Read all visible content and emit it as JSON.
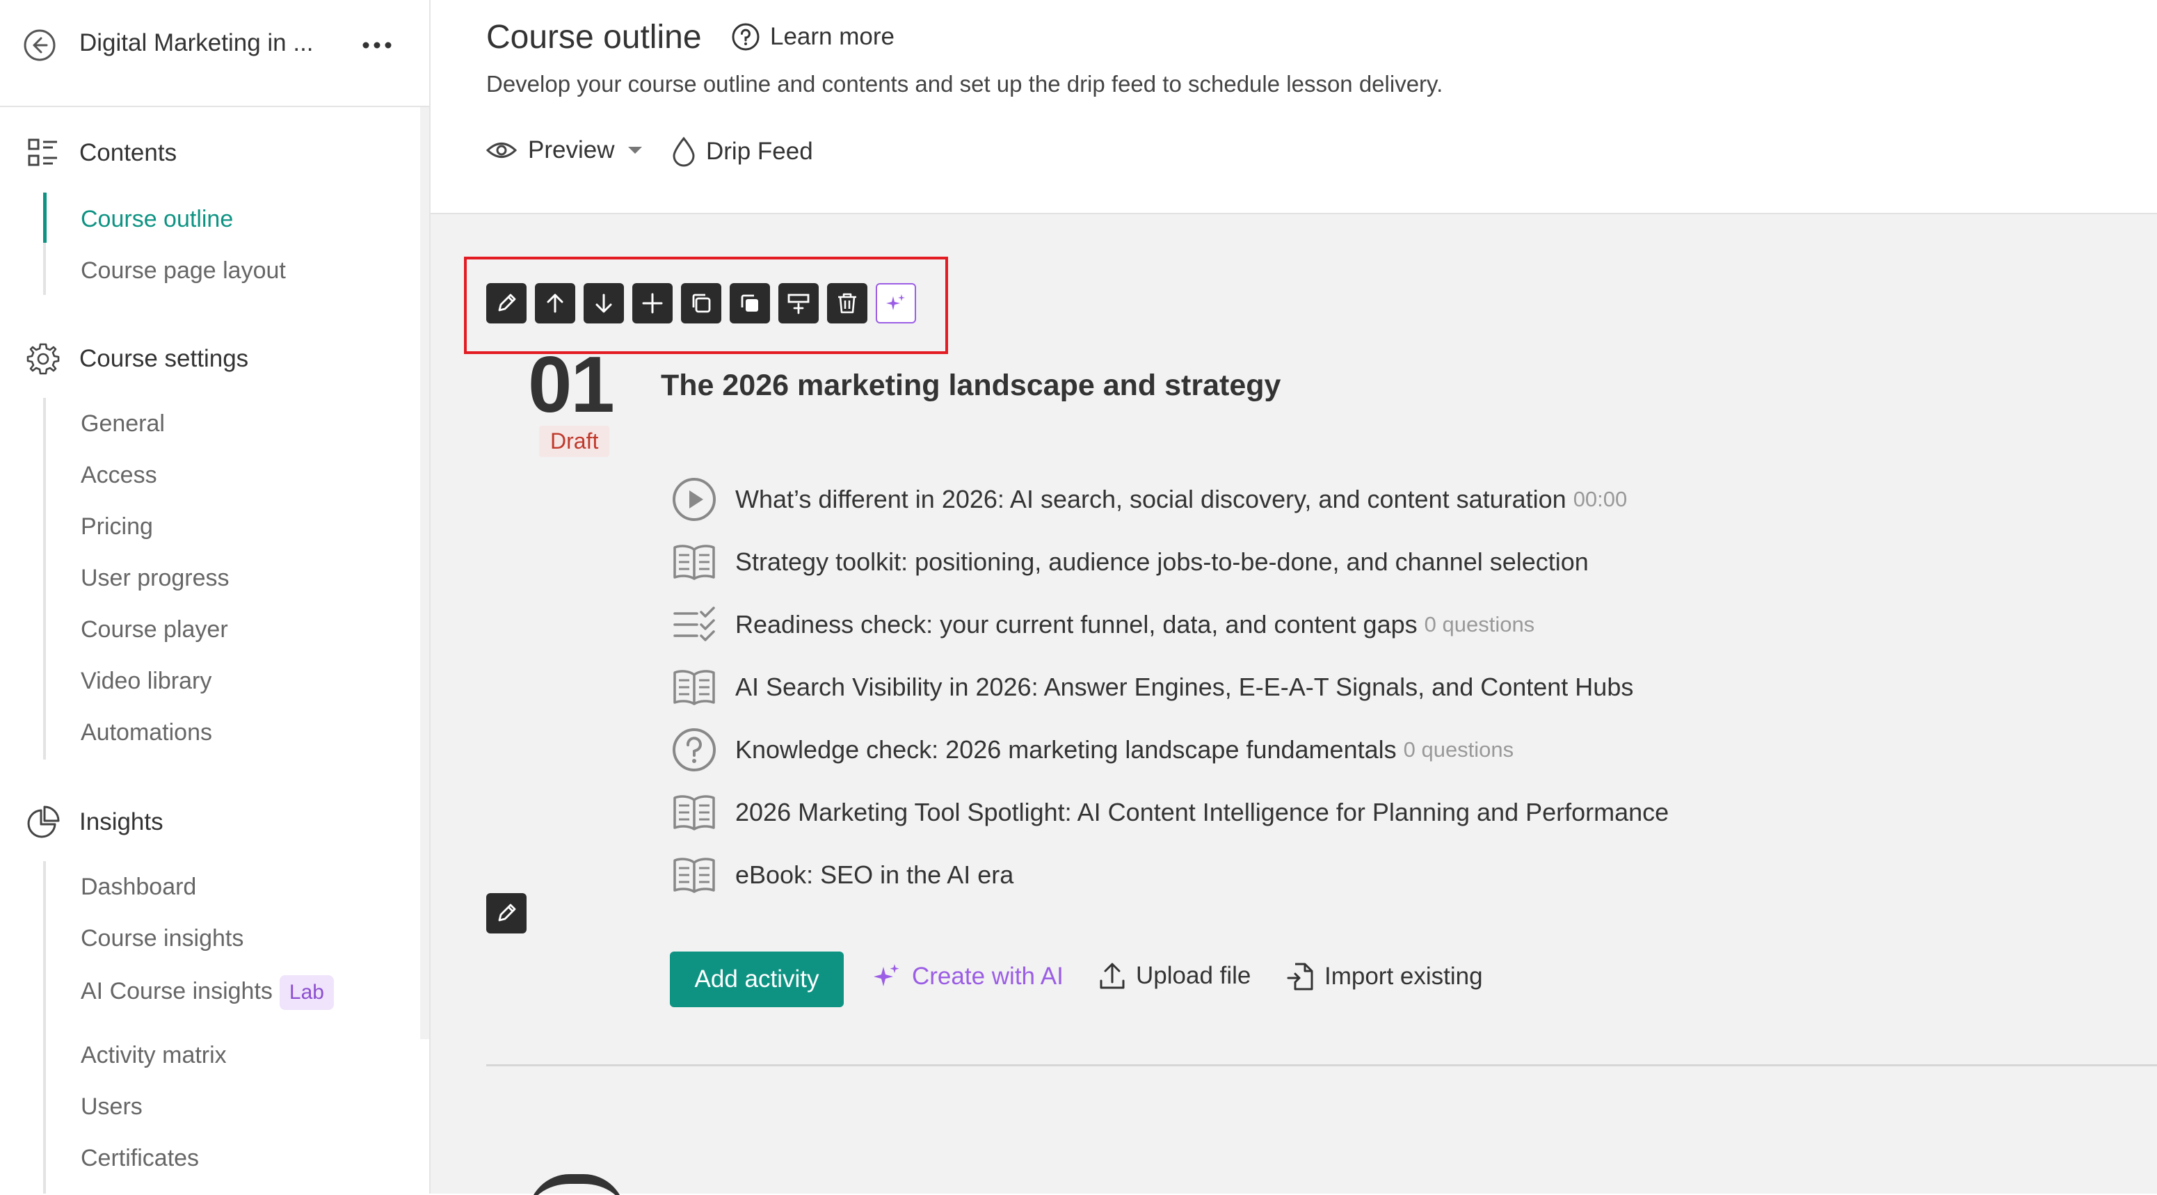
{
  "sidebar": {
    "course_name": "Digital Marketing in ...",
    "sections": [
      {
        "label": "Contents",
        "icon": "contents-list-icon"
      },
      {
        "label": "Course settings",
        "icon": "gear-icon"
      },
      {
        "label": "Insights",
        "icon": "pie-chart-icon"
      }
    ],
    "contents_items": [
      "Course outline",
      "Course page layout"
    ],
    "settings_items": [
      "General",
      "Access",
      "Pricing",
      "User progress",
      "Course player",
      "Video library",
      "Automations"
    ],
    "insights_items": [
      "Dashboard",
      "Course insights",
      "AI Course insights",
      "Activity matrix",
      "Users",
      "Certificates"
    ],
    "lab_badge": "Lab",
    "active_item": "Course outline"
  },
  "header": {
    "title": "Course outline",
    "learn_more": "Learn more",
    "description": "Develop your course outline and contents and set up the drip feed to schedule lesson delivery.",
    "preview": "Preview",
    "drip_feed": "Drip Feed"
  },
  "toolbar": {
    "buttons": [
      "edit-icon",
      "move-up-icon",
      "move-down-icon",
      "add-icon",
      "duplicate-icon",
      "copy-icon",
      "insert-icon",
      "trash-icon",
      "ai-sparkle-icon"
    ]
  },
  "module": {
    "number": "01",
    "status": "Draft",
    "title": "The 2026 marketing landscape and strategy",
    "activities": [
      {
        "type": "video",
        "icon": "play-circle-icon",
        "title": "What’s different in 2026: AI search, social discovery, and content saturation",
        "meta": "00:00"
      },
      {
        "type": "ebook",
        "icon": "open-book-icon",
        "title": "Strategy toolkit: positioning, audience jobs-to-be-done, and channel selection",
        "meta": ""
      },
      {
        "type": "survey",
        "icon": "checklist-icon",
        "title": "Readiness check: your current funnel, data, and content gaps",
        "meta": "0 questions"
      },
      {
        "type": "ebook",
        "icon": "open-book-icon",
        "title": "AI Search Visibility in 2026: Answer Engines, E-E-A-T Signals, and Content Hubs",
        "meta": ""
      },
      {
        "type": "quiz",
        "icon": "question-circle-icon",
        "title": "Knowledge check: 2026 marketing landscape fundamentals",
        "meta": "0 questions"
      },
      {
        "type": "ebook",
        "icon": "open-book-icon",
        "title": "2026 Marketing Tool Spotlight: AI Content Intelligence for Planning and Performance",
        "meta": ""
      },
      {
        "type": "ebook",
        "icon": "open-book-icon",
        "title": "eBook: SEO in the AI era",
        "meta": ""
      }
    ]
  },
  "actions": {
    "add_activity": "Add activity",
    "create_ai": "Create with AI",
    "upload": "Upload file",
    "import": "Import existing"
  },
  "colors": {
    "accent": "#0e9383",
    "ai": "#9b5de5",
    "highlight": "#e31b23",
    "draft": "#c0392b"
  }
}
